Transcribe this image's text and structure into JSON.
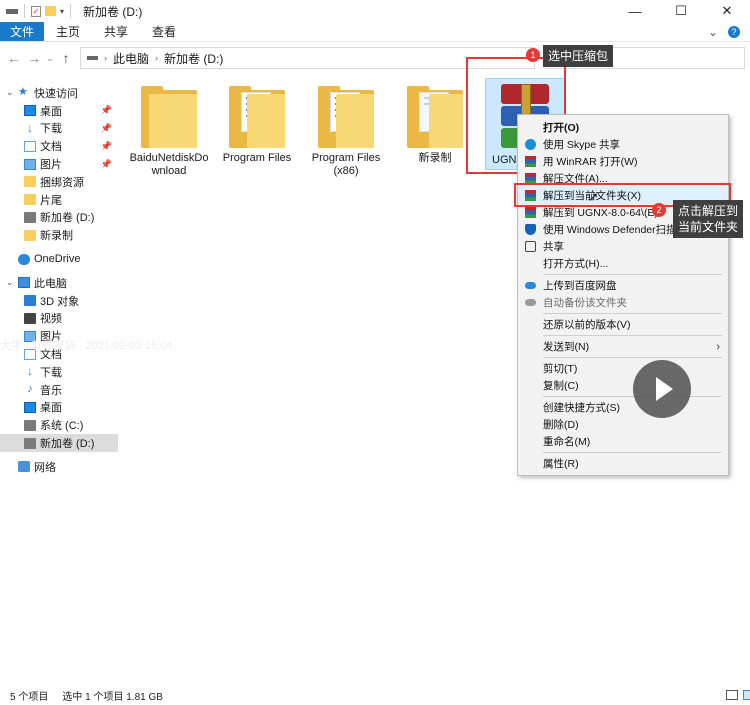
{
  "window": {
    "title": "新加卷 (D:)",
    "controls": [
      "—",
      "☐",
      "✕"
    ]
  },
  "ribbon": {
    "tabs": [
      "文件",
      "主页",
      "共享",
      "查看"
    ]
  },
  "address": {
    "path": [
      "此电脑",
      "新加卷 (D:)"
    ]
  },
  "sidebar": {
    "quick_access": "快速访问",
    "quick_items": [
      {
        "label": "桌面",
        "icon": "desktop-icon"
      },
      {
        "label": "下载",
        "icon": "download-icon"
      },
      {
        "label": "文档",
        "icon": "documents-icon"
      },
      {
        "label": "图片",
        "icon": "pictures-icon"
      },
      {
        "label": "捆绑资源",
        "icon": "folder-icon"
      },
      {
        "label": "片尾",
        "icon": "folder-icon"
      },
      {
        "label": "新加卷 (D:)",
        "icon": "drive-icon"
      },
      {
        "label": "新录制",
        "icon": "folder-icon"
      }
    ],
    "onedrive": "OneDrive",
    "this_pc": "此电脑",
    "pc_items": [
      {
        "label": "3D 对象",
        "icon": "3d-objects-icon"
      },
      {
        "label": "视频",
        "icon": "videos-icon"
      },
      {
        "label": "图片",
        "icon": "pictures-icon"
      },
      {
        "label": "文档",
        "icon": "documents-icon"
      },
      {
        "label": "下载",
        "icon": "download-icon"
      },
      {
        "label": "音乐",
        "icon": "music-icon"
      },
      {
        "label": "桌面",
        "icon": "desktop-icon"
      },
      {
        "label": "系统 (C:)",
        "icon": "drive-icon"
      },
      {
        "label": "新加卷 (D:)",
        "icon": "drive-icon"
      }
    ],
    "network": "网络"
  },
  "files": [
    {
      "name": "BaiduNetdiskDownload"
    },
    {
      "name": "Program Files"
    },
    {
      "name": "Program Files (x86)"
    },
    {
      "name": "新录制"
    },
    {
      "name": "UGN"
    }
  ],
  "annotations": {
    "step1_num": "1",
    "step1_text": "选中压缩包",
    "step2_num": "2",
    "step2_text_line1": "点击解压到",
    "step2_text_line2": "当前文件夹"
  },
  "context_menu": {
    "items": [
      {
        "label": "打开(O)",
        "bold": true
      },
      {
        "label": "使用 Skype 共享",
        "icon": "skype-icon"
      },
      {
        "label": "用 WinRAR 打开(W)",
        "icon": "winrar-icon"
      },
      {
        "label": "解压文件(A)...",
        "icon": "winrar-icon"
      },
      {
        "label": "解压到当前文件夹(X)",
        "icon": "winrar-icon",
        "highlight": true
      },
      {
        "label": "解压到 UGNX-8.0-64\\(E)",
        "icon": "winrar-icon"
      },
      {
        "label": "使用 Windows Defender扫描...",
        "icon": "defender-icon"
      },
      {
        "label": "共享",
        "icon": "share-icon"
      },
      {
        "label": "打开方式(H)..."
      },
      {
        "sep": true
      },
      {
        "label": "上传到百度网盘",
        "icon": "baidu-cloud-icon"
      },
      {
        "label": "自动备份该文件夹",
        "icon": "baidu-cloud-grey-icon",
        "disabled": true
      },
      {
        "sep": true
      },
      {
        "label": "还原以前的版本(V)"
      },
      {
        "sep": true
      },
      {
        "label": "发送到(N)",
        "submenu": true
      },
      {
        "sep": true
      },
      {
        "label": "剪切(T)"
      },
      {
        "label": "复制(C)"
      },
      {
        "sep": true
      },
      {
        "label": "创建快捷方式(S)"
      },
      {
        "label": "删除(D)"
      },
      {
        "label": "重命名(M)"
      },
      {
        "sep": true
      },
      {
        "label": "属性(R)"
      }
    ]
  },
  "watermark": "大学  ·  软件安装  ·  2021-02-02 15:04",
  "status": {
    "count": "5 个项目",
    "selection": "选中 1 个项目  1.81 GB"
  },
  "colors": {
    "accent": "#1979ca",
    "annotation": "#e53935",
    "selection": "#cce8ff",
    "folder": "#f8d775"
  }
}
